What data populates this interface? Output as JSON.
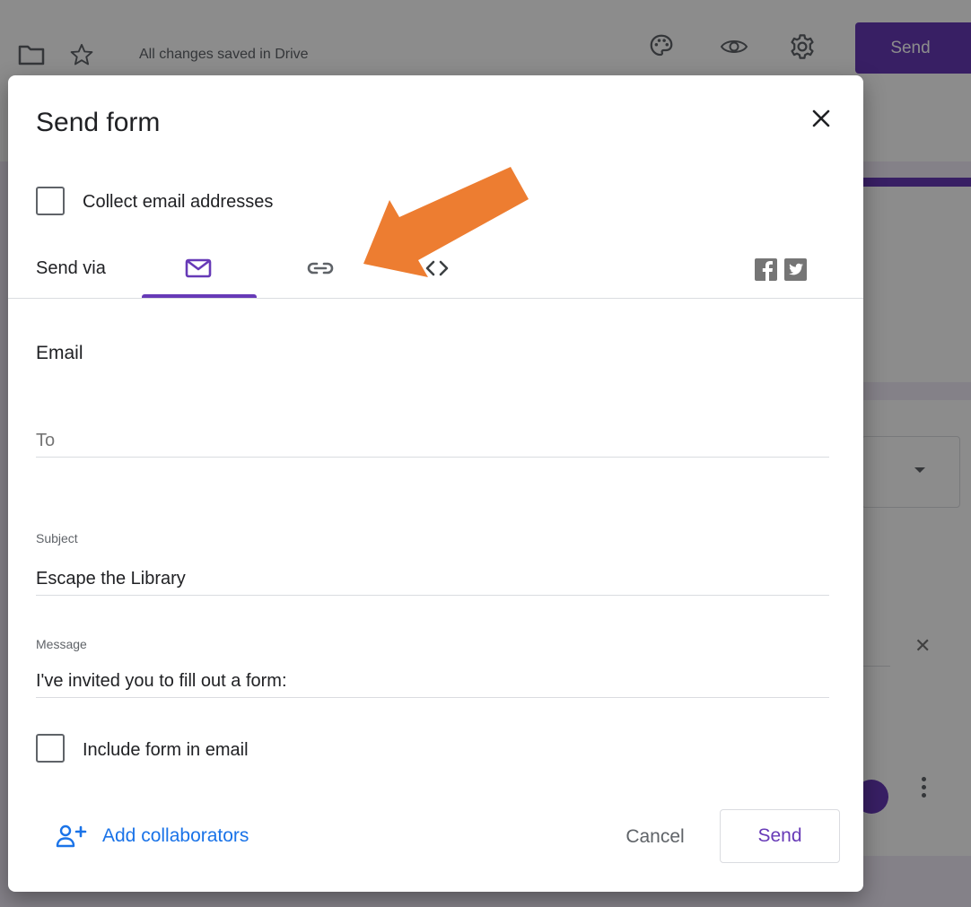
{
  "topbar": {
    "status_text": "All changes saved in Drive",
    "send_label": "Send",
    "icons": [
      "folder-icon",
      "star-icon",
      "palette-icon",
      "eye-icon",
      "gear-icon"
    ]
  },
  "dialog": {
    "title": "Send form",
    "close_icon": "close-icon",
    "collect_email": {
      "label": "Collect email addresses",
      "checked": false
    },
    "send_via": {
      "label": "Send via",
      "tabs": [
        {
          "name": "email",
          "icon": "mail-icon",
          "active": true
        },
        {
          "name": "link",
          "icon": "link-icon",
          "active": false
        },
        {
          "name": "embed",
          "icon": "code-icon",
          "active": false
        }
      ],
      "social": [
        "facebook-icon",
        "twitter-icon"
      ]
    },
    "email": {
      "section_title": "Email",
      "to": {
        "placeholder": "To",
        "value": ""
      },
      "subject": {
        "label": "Subject",
        "value": "Escape the Library"
      },
      "message": {
        "label": "Message",
        "value": "I've invited you to fill out a form:"
      }
    },
    "include_form": {
      "label": "Include form in email",
      "checked": false
    },
    "add_collaborators": {
      "label": "Add collaborators",
      "icon": "add-person-icon"
    },
    "cancel_label": "Cancel",
    "send_label": "Send"
  },
  "annotation": {
    "arrow_color": "#ed7d31",
    "target": "link-tab"
  },
  "colors": {
    "accent": "#673ab7",
    "link_blue": "#1a73e8",
    "arrow": "#ed7d31",
    "scrim": "rgba(0,0,0,0.45)"
  }
}
